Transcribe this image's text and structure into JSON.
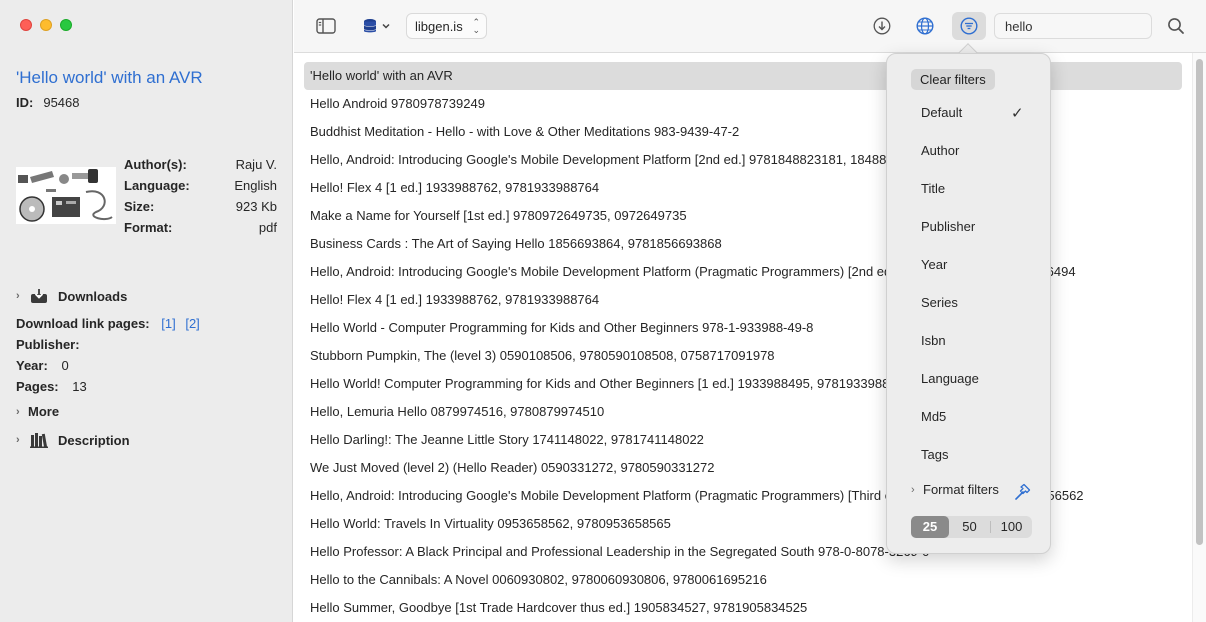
{
  "book": {
    "title": "'Hello world' with an AVR",
    "id_label": "ID:",
    "id_value": "95468",
    "meta": [
      {
        "key": "Author(s):",
        "value": "Raju V."
      },
      {
        "key": "Language:",
        "value": "English"
      },
      {
        "key": "Size:",
        "value": "923 Kb"
      },
      {
        "key": "Format:",
        "value": "pdf"
      }
    ],
    "downloads_label": "Downloads",
    "download_pages_label": "Download link pages:",
    "download_links": [
      "[1]",
      "[2]"
    ],
    "publisher_label": "Publisher:",
    "publisher_value": "",
    "year_label": "Year:",
    "year_value": "0",
    "pages_label": "Pages:",
    "pages_value": "13",
    "more_label": "More",
    "description_label": "Description"
  },
  "toolbar": {
    "source": "libgen.is",
    "search_value": "hello"
  },
  "results": [
    "'Hello world' with an AVR",
    "Hello Android 9780978739249",
    "Buddhist Meditation - Hello - with Love & Other Meditations 983-9439-47-2",
    "Hello, Android: Introducing Google's Mobile Development Platform [2nd ed.] 9781848823181, 1848823185",
    "Hello! Flex 4 [1 ed.] 1933988762, 9781933988764",
    "Make a Name for Yourself [1st ed.] 9780972649735, 0972649735",
    "Business Cards : The Art of Saying Hello 1856693864, 9781856693868",
    "Hello, Android: Introducing Google's Mobile Development Platform (Pragmatic Programmers) [2nd ed.] 1934356492, 9781934356494",
    "Hello! Flex 4 [1 ed.] 1933988762, 9781933988764",
    "Hello World - Computer Programming for Kids and Other Beginners 978-1-933988-49-8",
    "Stubborn Pumpkin, The (level 3) 0590108506, 9780590108508, 0758717091978",
    "Hello World! Computer Programming for Kids and Other Beginners [1 ed.] 1933988495, 9781933988498",
    "Hello, Lemuria Hello 0879974516, 9780879974510",
    "Hello Darling!: The Jeanne Little Story 1741148022, 9781741148022",
    "We Just Moved (level 2) (Hello Reader) 0590331272, 9780590331272",
    "Hello, Android: Introducing Google's Mobile Development Platform (Pragmatic Programmers) [Third ed.] 1934356565, 9781934356562",
    "Hello World: Travels In Virtuality 0953658562, 9780953658565",
    "Hello Professor: A Black Principal and Professional Leadership in the Segregated South 978-0-8078-3269-0",
    "Hello to the Cannibals: A Novel 0060930802, 9780060930806, 9780061695216",
    "Hello Summer, Goodbye [1st Trade Hardcover thus ed.] 1905834527, 9781905834525"
  ],
  "filter_menu": {
    "clear_label": "Clear filters",
    "sort_options": [
      "Default",
      "Author",
      "Title",
      "Publisher",
      "Year",
      "Series",
      "Isbn",
      "Language",
      "Md5",
      "Tags"
    ],
    "selected_check": "✓",
    "format_filters_label": "Format filters",
    "page_sizes": [
      "25",
      "50",
      "100"
    ]
  },
  "colors": {
    "accent": "#2f6fd1",
    "popover_bg": "#ededed",
    "selected_row": "#dcdcdc"
  }
}
